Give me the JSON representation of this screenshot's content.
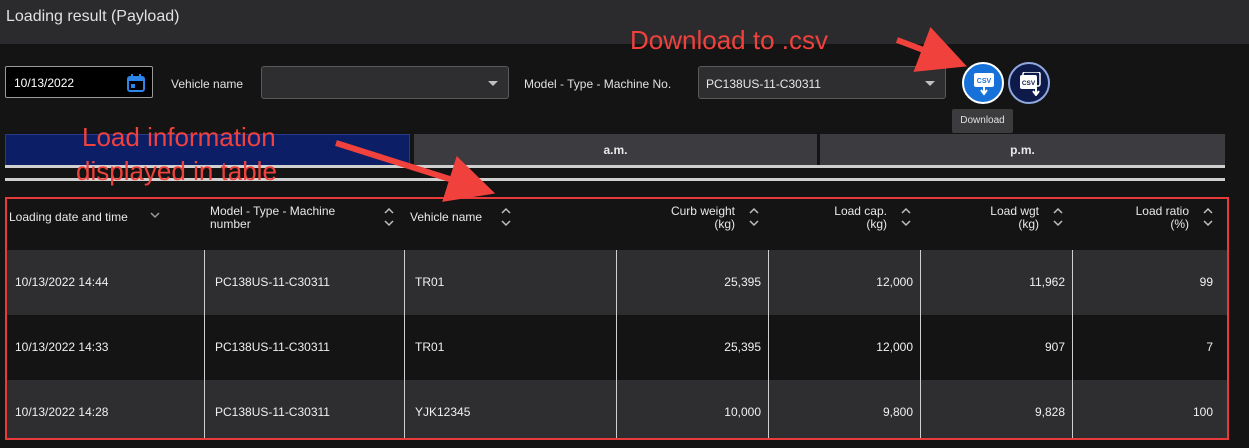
{
  "title": "Loading result (Payload)",
  "filters": {
    "date": "10/13/2022",
    "vehicle_label": "Vehicle name",
    "vehicle_value": "",
    "model_label": "Model - Type - Machine No.",
    "model_value": "PC138US-11-C30311"
  },
  "buttons": {
    "csv_label": "CSV",
    "tooltip": "Download"
  },
  "annotations": {
    "download": "Download to .csv",
    "load_line1": "Load information",
    "load_line2": "displayed in table"
  },
  "tabs": [
    "",
    "a.m.",
    "p.m."
  ],
  "table": {
    "headers": [
      {
        "line1": "Loading date and time",
        "line2": ""
      },
      {
        "line1": "Model - Type - Machine",
        "line2": "number"
      },
      {
        "line1": "Vehicle name",
        "line2": ""
      },
      {
        "line1": "Curb weight",
        "line2": "(kg)"
      },
      {
        "line1": "Load cap.",
        "line2": "(kg)"
      },
      {
        "line1": "Load wgt",
        "line2": "(kg)"
      },
      {
        "line1": "Load ratio",
        "line2": "(%)"
      }
    ],
    "rows": [
      [
        "10/13/2022 14:44",
        "PC138US-11-C30311",
        "TR01",
        "25,395",
        "12,000",
        "11,962",
        "99"
      ],
      [
        "10/13/2022 14:33",
        "PC138US-11-C30311",
        "TR01",
        "25,395",
        "12,000",
        "907",
        "7"
      ],
      [
        "10/13/2022 14:28",
        "PC138US-11-C30311",
        "YJK12345",
        "10,000",
        "9,800",
        "9,828",
        "100"
      ]
    ]
  },
  "colors": {
    "accent": "#1672d9",
    "annotation": "#f0413c",
    "tab_active": "#0b1e66"
  }
}
